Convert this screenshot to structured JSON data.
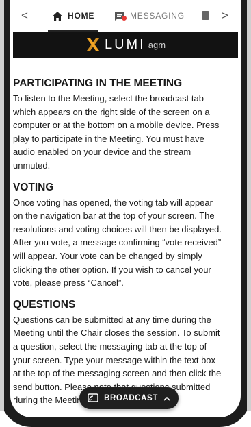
{
  "tabs": {
    "prev_arrow": "<",
    "next_arrow": ">",
    "home_label": "HOME",
    "messaging_label": "MESSAGING"
  },
  "logo": {
    "word": "LUMI",
    "suffix": "agm",
    "accent_color": "#f5a623"
  },
  "sections": [
    {
      "heading": "PARTICIPATING IN THE MEETING",
      "body": "To listen to the Meeting, select the broadcast tab which appears on the right side of the screen on a computer or at the bottom on a mobile device. Press play to participate in the Meeting. You must have audio enabled on your device and the stream unmuted."
    },
    {
      "heading": "VOTING",
      "body": "Once voting has opened, the voting tab will appear on the navigation bar at the top of your screen. The resolutions and voting choices will then be displayed. After you vote, a message confirming “vote received” will appear. Your vote can be changed by simply clicking the other option. If you wish to cancel your vote, please press “Cancel”."
    },
    {
      "heading": "QUESTIONS",
      "body": "Questions can be submitted at any time during the Meeting until the Chair closes the session. To submit a question, select the messaging tab at the top of your screen. Type your message within the text box at the top of the messaging screen and then click the send button. Please note that questions submitted during the Meeting via the"
    }
  ],
  "broadcast": {
    "label": "BROADCAST"
  },
  "colors": {
    "badge": "#e53935",
    "logo_bar": "#121212"
  }
}
